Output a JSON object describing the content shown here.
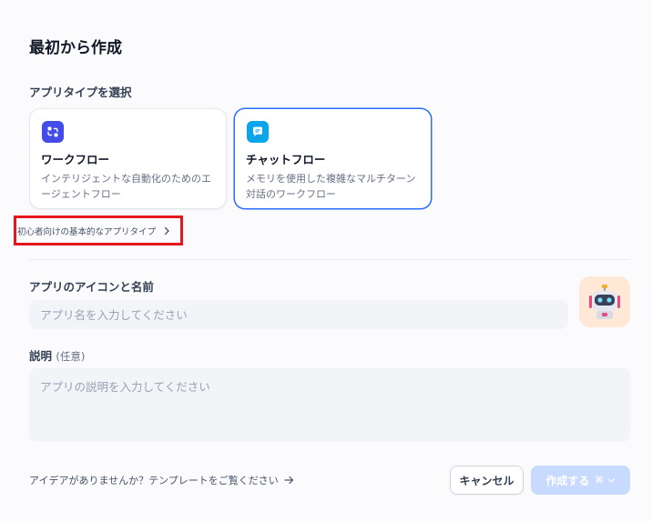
{
  "dialog": {
    "title": "最初から作成"
  },
  "app_type": {
    "label": "アプリタイプを選択",
    "cards": [
      {
        "title": "ワークフロー",
        "description": "インテリジェントな自動化のためのエージェントフロー",
        "icon": "workflow-icon",
        "color": "#444ce7",
        "selected": false
      },
      {
        "title": "チャットフロー",
        "description": "メモリを使用した複雑なマルチターン対話のワークフロー",
        "icon": "chatflow-icon",
        "color": "#0ba5ec",
        "selected": true
      }
    ],
    "basic_link": "初心者向けの基本的なアプリタイプ"
  },
  "name": {
    "label": "アプリのアイコンと名前",
    "placeholder": "アプリ名を入力してください",
    "value": "",
    "avatar_icon": "robot-avatar-icon"
  },
  "description": {
    "label": "説明",
    "optional": "(任意)",
    "placeholder": "アプリの説明を入力してください",
    "value": ""
  },
  "footer": {
    "template_link": "アイデアがありませんか？テンプレートをご覧ください",
    "cancel": "キャンセル",
    "create": "作成する",
    "shortcut": "⌘",
    "accent": "#296dff",
    "disabled_color": "#c8daff"
  }
}
